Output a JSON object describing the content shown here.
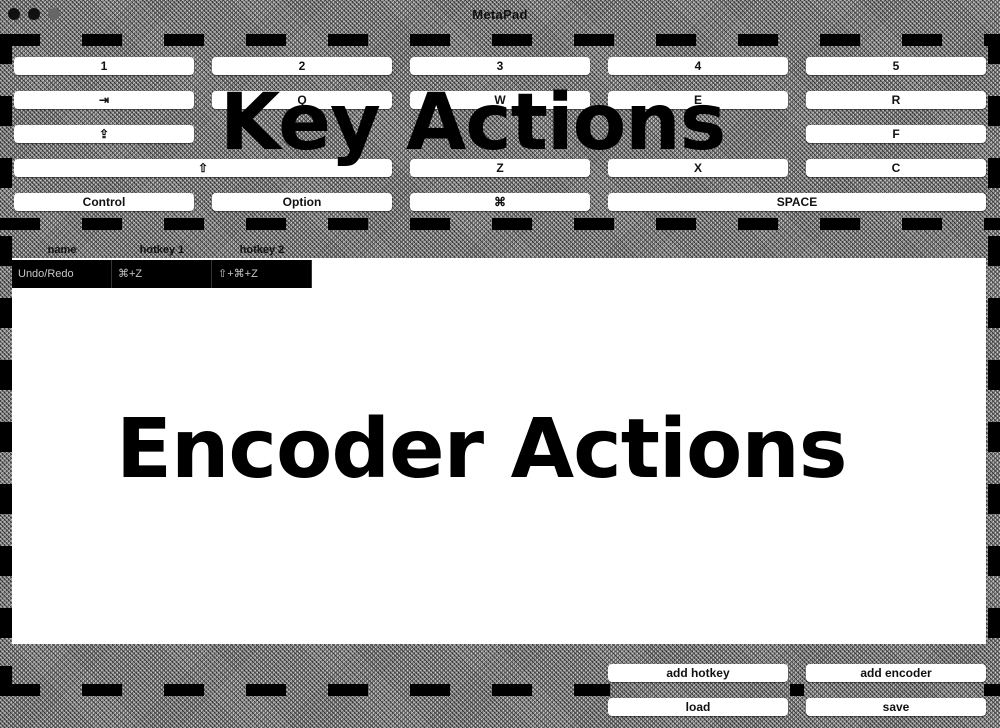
{
  "window": {
    "title": "MetaPad"
  },
  "keys": {
    "row1": [
      "1",
      "2",
      "3",
      "4",
      "5"
    ],
    "row2": [
      "⇥",
      "Q",
      "W",
      "E",
      "R"
    ],
    "row3": [
      "⇪",
      "F"
    ],
    "row4": [
      "⇧",
      "Z",
      "X",
      "C"
    ],
    "row5": [
      "Control",
      "Option",
      "⌘",
      "SPACE"
    ]
  },
  "sections": {
    "key_actions": "Key Actions",
    "encoder_actions": "Encoder Actions"
  },
  "table": {
    "headers": [
      "name",
      "hotkey 1",
      "hotkey 2"
    ],
    "rows": [
      {
        "name": "Undo/Redo",
        "hotkey1": "⌘+Z",
        "hotkey2": "⇧+⌘+Z"
      }
    ]
  },
  "buttons": {
    "add_hotkey": "add hotkey",
    "add_encoder": "add encoder",
    "load": "load",
    "save": "save"
  }
}
